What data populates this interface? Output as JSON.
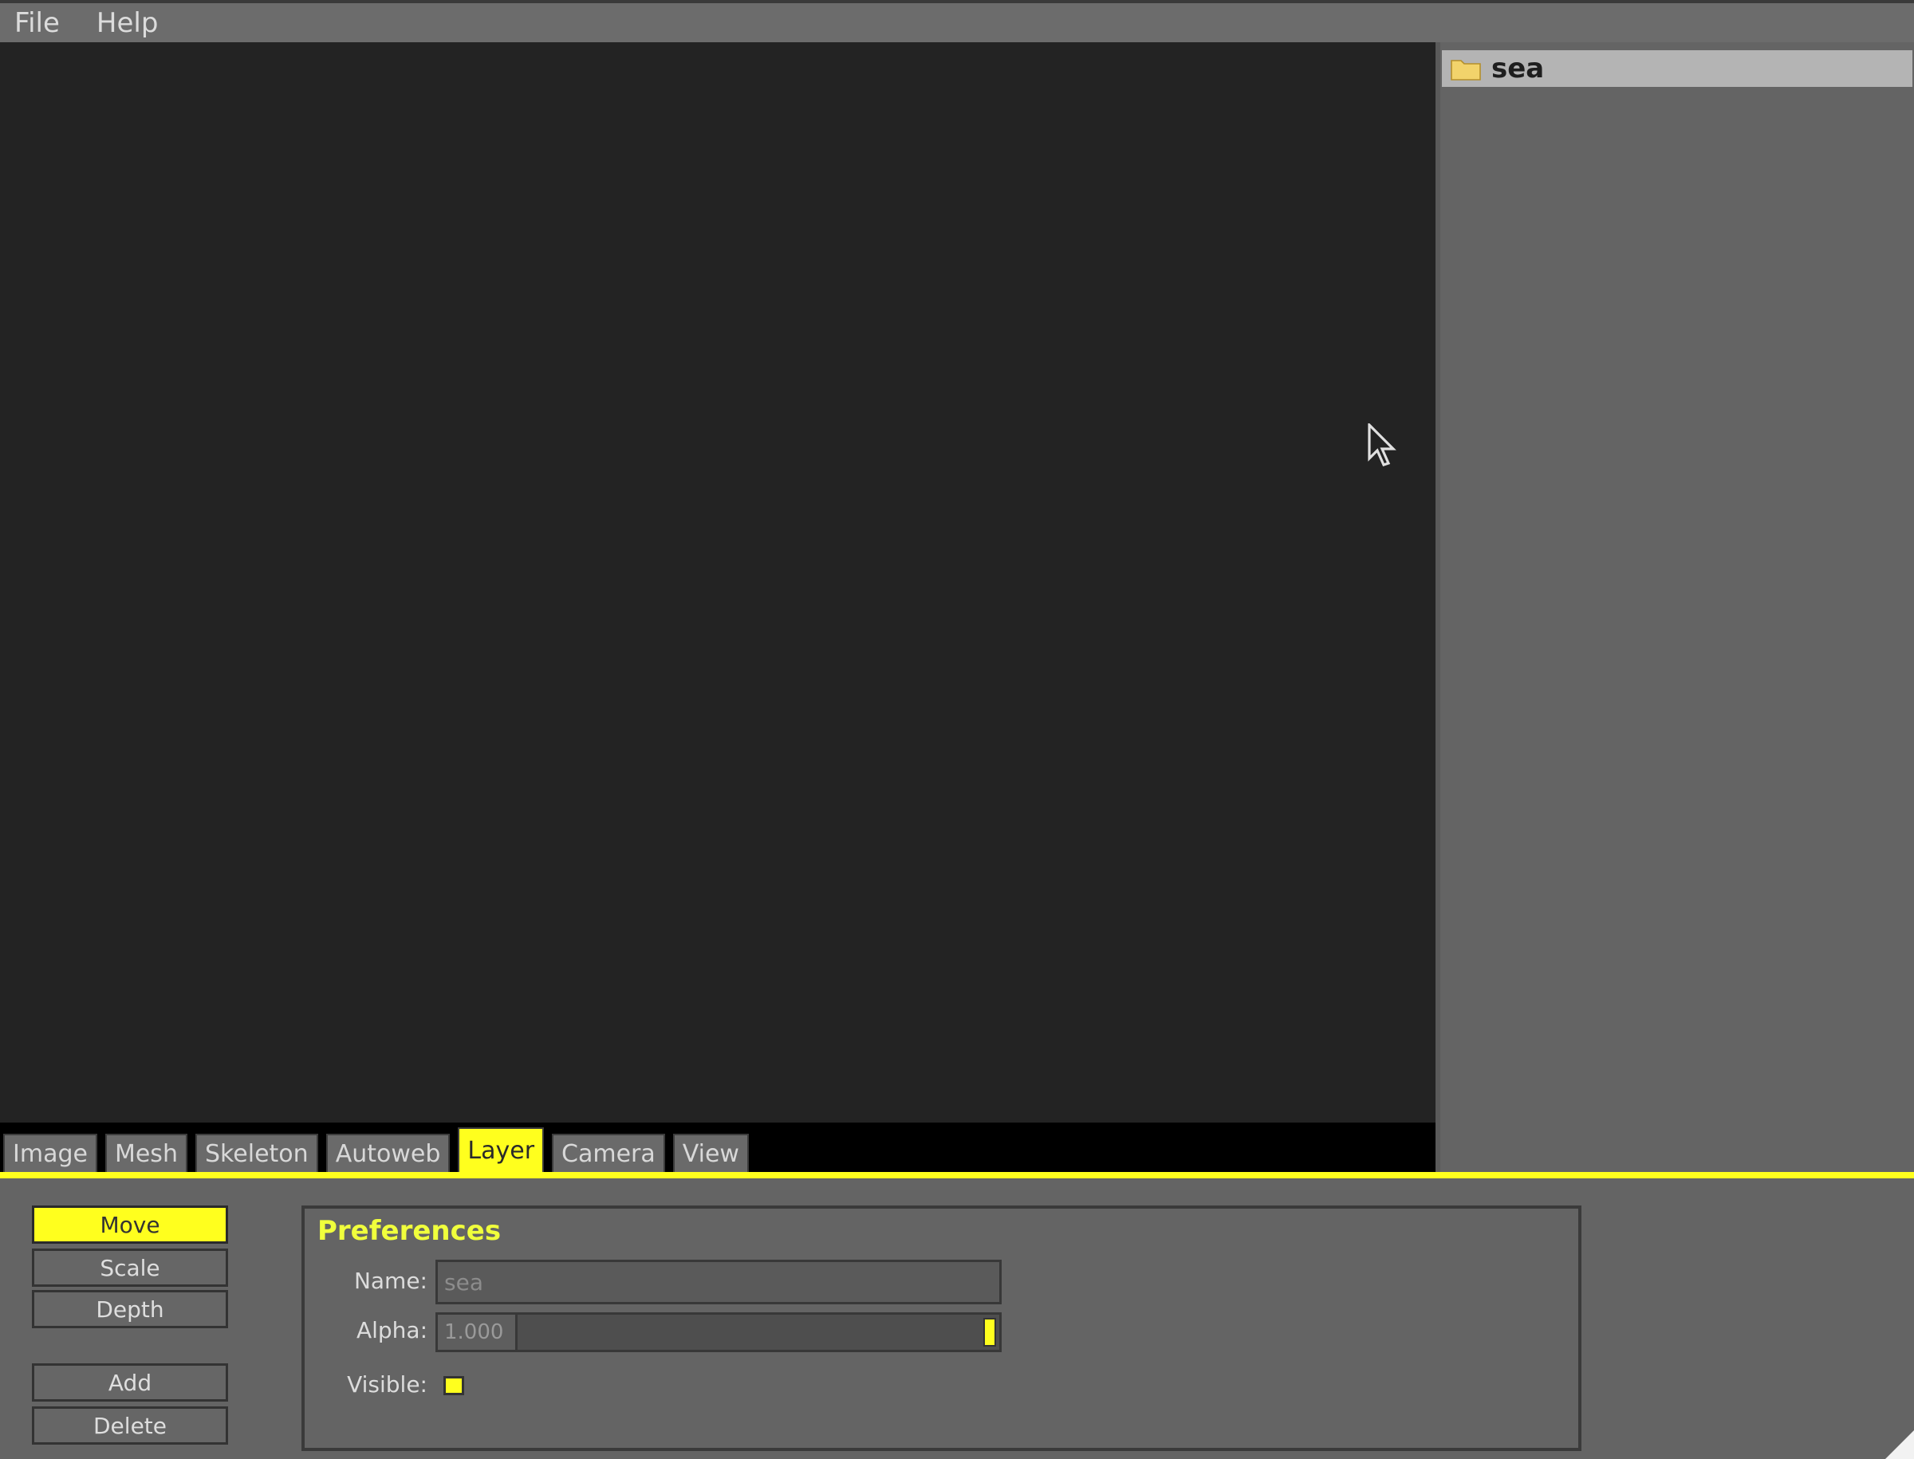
{
  "menu": {
    "file_label": "File",
    "help_label": "Help"
  },
  "tree": {
    "items": [
      {
        "label": "sea"
      }
    ]
  },
  "tabs": [
    {
      "label": "Image"
    },
    {
      "label": "Mesh"
    },
    {
      "label": "Skeleton"
    },
    {
      "label": "Autoweb"
    },
    {
      "label": "Layer"
    },
    {
      "label": "Camera"
    },
    {
      "label": "View"
    }
  ],
  "active_tab": "Layer",
  "tools": {
    "move_label": "Move",
    "scale_label": "Scale",
    "depth_label": "Depth",
    "add_label": "Add",
    "delete_label": "Delete"
  },
  "preferences": {
    "title": "Preferences",
    "name_label": "Name:",
    "name_value": "sea",
    "alpha_label": "Alpha:",
    "alpha_value": "1.000",
    "alpha_fraction": 1.0,
    "visible_label": "Visible:",
    "visible_checked": true
  },
  "colors": {
    "accent": "#ffff1e",
    "canvas": "#232323",
    "panel": "#646464"
  }
}
